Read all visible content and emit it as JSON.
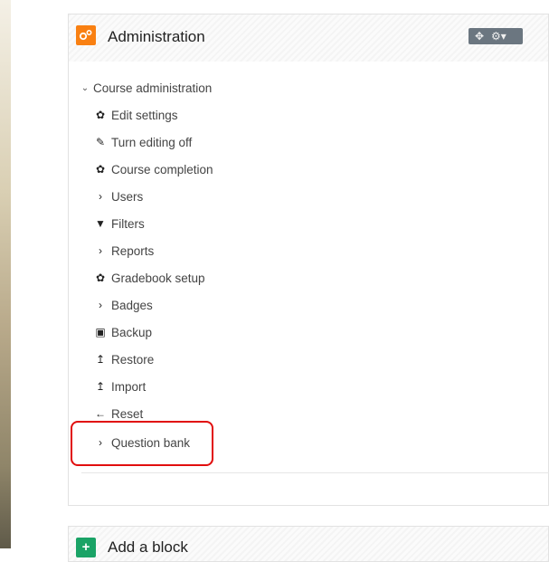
{
  "admin_block": {
    "title": "Administration",
    "icon": "gears-icon",
    "controls": [
      "move-icon",
      "settings-dropdown-icon"
    ],
    "section_label": "Course administration",
    "items": [
      {
        "label": "Edit settings",
        "icon": "gear-icon",
        "type": "link"
      },
      {
        "label": "Turn editing off",
        "icon": "pencil-icon",
        "type": "link"
      },
      {
        "label": "Course completion",
        "icon": "gear-icon",
        "type": "link"
      },
      {
        "label": "Users",
        "icon": "chevron-right-icon",
        "type": "branch"
      },
      {
        "label": "Filters",
        "icon": "filter-icon",
        "type": "link"
      },
      {
        "label": "Reports",
        "icon": "chevron-right-icon",
        "type": "branch"
      },
      {
        "label": "Gradebook setup",
        "icon": "gear-icon",
        "type": "link"
      },
      {
        "label": "Badges",
        "icon": "chevron-right-icon",
        "type": "branch"
      },
      {
        "label": "Backup",
        "icon": "file-icon",
        "type": "link"
      },
      {
        "label": "Restore",
        "icon": "upload-icon",
        "type": "link"
      },
      {
        "label": "Import",
        "icon": "upload-icon",
        "type": "link"
      },
      {
        "label": "Reset",
        "icon": "arrow-left-icon",
        "type": "link"
      },
      {
        "label": "Question bank",
        "icon": "chevron-right-icon",
        "type": "branch"
      }
    ],
    "highlight_color": "#e10e0e"
  },
  "add_block": {
    "title": "Add a block",
    "icon": "plus-icon"
  },
  "colors": {
    "admin_icon_bg": "#f98012",
    "add_block_icon_bg": "#1aa366",
    "controls_bg": "#6b7680"
  }
}
